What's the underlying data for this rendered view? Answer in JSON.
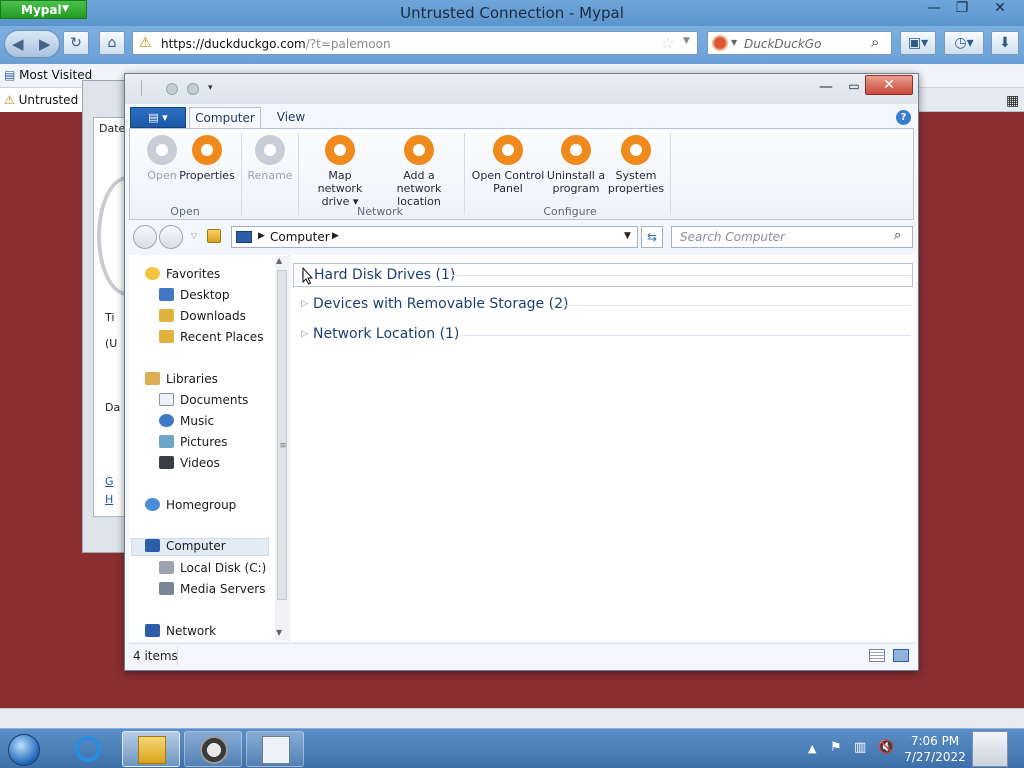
{
  "browser": {
    "app_menu": "Mypal",
    "title": "Untrusted Connection - Mypal",
    "url_host": "https://duckduckgo.com",
    "url_path": "/?t=palemoon",
    "search_placeholder": "DuckDuckGo",
    "bookmark": "Most Visited",
    "tab_label": "Untrusted Connection"
  },
  "bg_dialog": {
    "date_label": "Date",
    "t1": "Ti",
    "t2": "(U",
    "t3": "Da",
    "link1": "G",
    "link2": "H"
  },
  "explorer": {
    "ribbon_tabs": [
      "Computer",
      "View"
    ],
    "ribbon": {
      "open": [
        "Open",
        "Properties"
      ],
      "rename": "Rename",
      "network": [
        "Map network drive ▾",
        "Add a network location"
      ],
      "configure": [
        "Open Control Panel",
        "Uninstall a program",
        "System properties"
      ],
      "groups": [
        "Open",
        "Network",
        "Configure"
      ]
    },
    "address": "Computer",
    "search_placeholder": "Search Computer",
    "nav": {
      "favorites": "Favorites",
      "desktop": "Desktop",
      "downloads": "Downloads",
      "recent": "Recent Places",
      "libraries": "Libraries",
      "documents": "Documents",
      "music": "Music",
      "pictures": "Pictures",
      "videos": "Videos",
      "homegroup": "Homegroup",
      "computer": "Computer",
      "local_disk": "Local Disk (C:)",
      "media_servers": "Media Servers",
      "network": "Network"
    },
    "groups": [
      "Hard Disk Drives (1)",
      "Devices with Removable Storage (2)",
      "Network Location (1)"
    ],
    "status": "4 items"
  },
  "taskbar": {
    "time": "7:06 PM",
    "date": "7/27/2022"
  }
}
